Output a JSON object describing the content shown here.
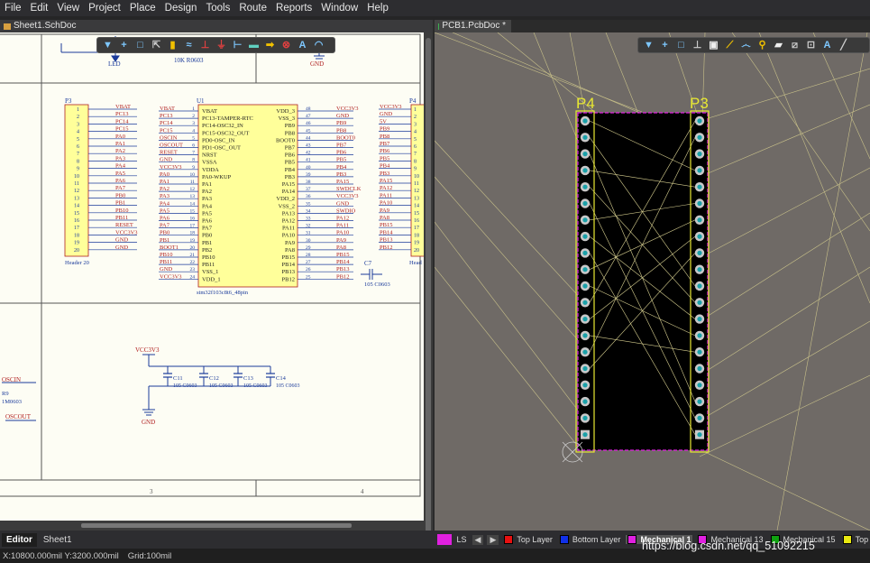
{
  "menubar": {
    "items": [
      "File",
      "Edit",
      "View",
      "Project",
      "Place",
      "Design",
      "Tools",
      "Route",
      "Reports",
      "Window",
      "Help"
    ]
  },
  "tabs": {
    "schematic": "Sheet1.SchDoc",
    "pcb": "PCB1.PcbDoc *"
  },
  "schematic": {
    "top_labels": [
      "LED",
      "10K R0603",
      "GND"
    ],
    "p3": {
      "designator": "P3",
      "pins": [
        "1",
        "2",
        "3",
        "4",
        "5",
        "6",
        "7",
        "8",
        "9",
        "10",
        "11",
        "12",
        "13",
        "14",
        "15",
        "16",
        "17",
        "18",
        "19",
        "20"
      ],
      "nets": [
        "VBAT",
        "PC13",
        "PC14",
        "PC15",
        "PA0",
        "PA1",
        "PA2",
        "PA3",
        "PA4",
        "PA5",
        "PA6",
        "PA7",
        "PB0",
        "PB1",
        "PB10",
        "PB11",
        "RESET",
        "VCC3V3",
        "GND",
        "GND"
      ],
      "footer": "Header 20"
    },
    "u1": {
      "designator": "U1",
      "left_nets": [
        "VBAT",
        "PC13",
        "PC14",
        "PC15",
        "OSCIN",
        "OSCOUT",
        "RESET",
        "GND",
        "VCC3V3",
        "PA0",
        "PA1",
        "PA2",
        "PA3",
        "PA4",
        "PA5",
        "PA6",
        "PA7",
        "PB0",
        "PB1",
        "BOOT1",
        "PB10",
        "PB11",
        "GND",
        "VCC3V3"
      ],
      "left_pin_nums": [
        "1",
        "2",
        "3",
        "4",
        "5",
        "6",
        "7",
        "8",
        "9",
        "10",
        "11",
        "12",
        "13",
        "14",
        "15",
        "16",
        "17",
        "18",
        "19",
        "20",
        "21",
        "22",
        "23",
        "24"
      ],
      "left_pin_names": [
        "VBAT",
        "PC13-TAMPER-RTC",
        "PC14-OSC32_IN",
        "PC15-OSC32_OUT",
        "PD0-OSC_IN",
        "PD1-OSC_OUT",
        "NRST",
        "VSSA",
        "VDDA",
        "PA0-WKUP",
        "PA1",
        "PA2",
        "PA3",
        "PA4",
        "PA5",
        "PA6",
        "PA7",
        "PB0",
        "PB1",
        "PB2",
        "PB10",
        "PB11",
        "VSS_1",
        "VDD_1"
      ],
      "right_pin_names": [
        "VDD_3",
        "VSS_3",
        "PB9",
        "PB8",
        "BOOT0",
        "PB7",
        "PB6",
        "PB5",
        "PB4",
        "PB3",
        "PA15",
        "PA14",
        "VDD_2",
        "VSS_2",
        "PA13",
        "PA12",
        "PA11",
        "PA10",
        "PA9",
        "PA8",
        "PB15",
        "PB14",
        "PB13",
        "PB12"
      ],
      "right_pin_nums": [
        "48",
        "47",
        "46",
        "45",
        "44",
        "43",
        "42",
        "41",
        "40",
        "39",
        "38",
        "37",
        "36",
        "35",
        "34",
        "33",
        "32",
        "31",
        "30",
        "29",
        "28",
        "27",
        "26",
        "25"
      ],
      "right_nets": [
        "VCC3V3",
        "GND",
        "PB9",
        "PB8",
        "BOOT0",
        "PB7",
        "PB6",
        "PB5",
        "PB4",
        "PB3",
        "PA15",
        "SWDCLK",
        "VCC3V3",
        "GND",
        "SWDIO",
        "PA12",
        "PA11",
        "PA10",
        "PA9",
        "PA8",
        "PB15",
        "PB14",
        "PB13",
        "PB12"
      ],
      "part": "stm32f103c8t6_48pin"
    },
    "p4": {
      "designator": "P4",
      "nets": [
        "VCC3V3",
        "GND",
        "5V",
        "PB9",
        "PB8",
        "PB7",
        "PB6",
        "PB5",
        "PB4",
        "PB3",
        "PA15",
        "PA12",
        "PA11",
        "PA10",
        "PA9",
        "PA8",
        "PB15",
        "PB14",
        "PB13",
        "PB12"
      ],
      "pins": [
        "1",
        "2",
        "3",
        "4",
        "5",
        "6",
        "7",
        "8",
        "9",
        "10",
        "11",
        "12",
        "13",
        "14",
        "15",
        "16",
        "17",
        "18",
        "19",
        "20"
      ],
      "footer": "Head"
    },
    "c7": {
      "designator": "C7",
      "value": "105 C0603"
    },
    "vcc_label": "VCC3V3",
    "caps": [
      {
        "designator": "C11",
        "value": "105 C0603"
      },
      {
        "designator": "C12",
        "value": "105 C0603"
      },
      {
        "designator": "C13",
        "value": "105 C0603"
      },
      {
        "designator": "C14",
        "value": "105 C0603"
      }
    ],
    "gnd_label": "GND",
    "left_labels": {
      "oscin": "OSCIN",
      "r9": "R9",
      "r9_value": "1M0603",
      "oscout": "OSCOUT"
    },
    "zones": [
      "3",
      "4"
    ]
  },
  "pcb": {
    "labels": {
      "left": "P4",
      "right": "P3"
    },
    "board_fill": "#000000",
    "outline_color": "#e020e0",
    "silk_color": "#e8e832",
    "pad_count_per_column": 20
  },
  "bottom_tabs": [
    "Editor",
    "Sheet1"
  ],
  "layer_bar": {
    "ls": "LS",
    "layers": [
      {
        "name": "Top Layer",
        "color": "#e81010"
      },
      {
        "name": "Bottom Layer",
        "color": "#1030e8"
      },
      {
        "name": "Mechanical 1",
        "color": "#e020e0"
      },
      {
        "name": "Mechanical 13",
        "color": "#e020e0"
      },
      {
        "name": "Mechanical 15",
        "color": "#10a010"
      },
      {
        "name": "Top",
        "color": "#e8e810"
      }
    ]
  },
  "status": {
    "coords": "X:10800.000mil Y:3200.000mil",
    "grid": "Grid:100mil"
  },
  "watermark": "https://blog.csdn.net/qq_51092215"
}
